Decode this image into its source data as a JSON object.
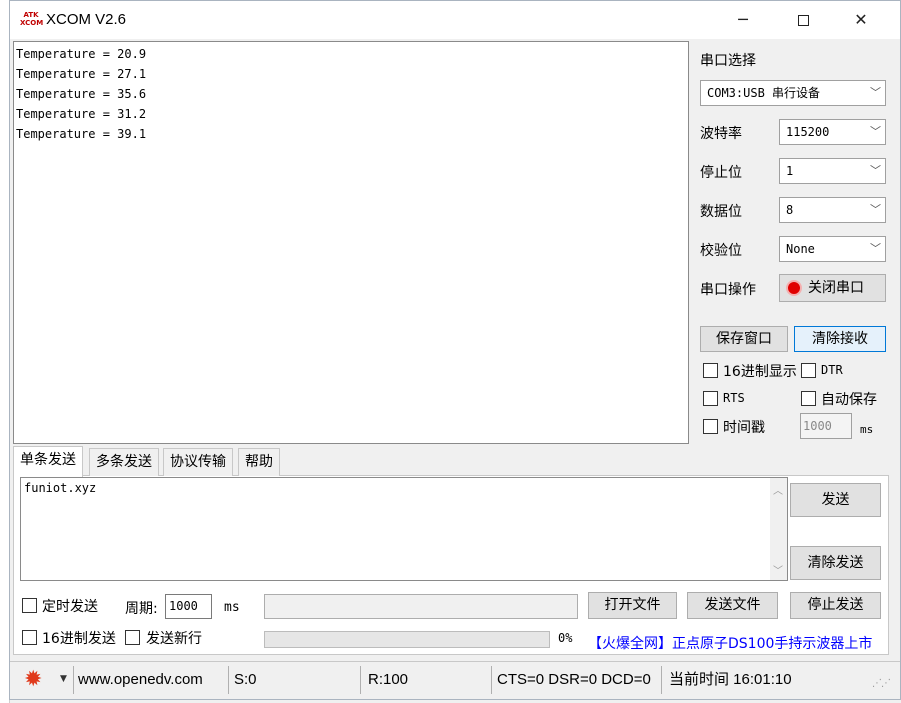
{
  "window": {
    "title": "XCOM V2.6",
    "logo_text": "ATK XCOM"
  },
  "receive": {
    "lines": [
      "Temperature = 20.9",
      "Temperature = 27.1",
      "Temperature = 35.6",
      "Temperature = 31.2",
      "Temperature = 39.1"
    ]
  },
  "serial": {
    "port_select_label": "串口选择",
    "port_value": "COM3:USB 串行设备",
    "baud_label": "波特率",
    "baud_value": "115200",
    "stop_label": "停止位",
    "stop_value": "1",
    "data_label": "数据位",
    "data_value": "8",
    "parity_label": "校验位",
    "parity_value": "None",
    "op_label": "串口操作",
    "close_port_label": "关闭串口",
    "save_window_label": "保存窗口",
    "clear_receive_label": "清除接收",
    "hex_display_label": "16进制显示",
    "dtr_label": "DTR",
    "rts_label": "RTS",
    "auto_save_label": "自动保存",
    "timestamp_label": "时间戳",
    "timestamp_value": "1000",
    "ms_label": "ms"
  },
  "tabs": [
    "单条发送",
    "多条发送",
    "协议传输",
    "帮助"
  ],
  "send": {
    "text": "funiot.xyz",
    "send_label": "发送",
    "clear_send_label": "清除发送",
    "timed_send_label": "定时发送",
    "period_label": "周期:",
    "period_value": "1000",
    "ms_label": "ms",
    "open_file_label": "打开文件",
    "send_file_label": "发送文件",
    "stop_send_label": "停止发送",
    "hex_send_label": "16进制发送",
    "send_newline_label": "发送新行",
    "progress_text": "0%",
    "progress": 0,
    "ad_text": "【火爆全网】正点原子DS100手持示波器上市"
  },
  "statusbar": {
    "website": "www.openedv.com",
    "sent": "S:0",
    "received": "R:100",
    "lines": "CTS=0 DSR=0 DCD=0",
    "time": "当前时间 16:01:10"
  },
  "colors": {
    "accent": "#0078d7",
    "ad": "#0000ff",
    "gear": "#e03a1c",
    "record": "#e00000"
  }
}
